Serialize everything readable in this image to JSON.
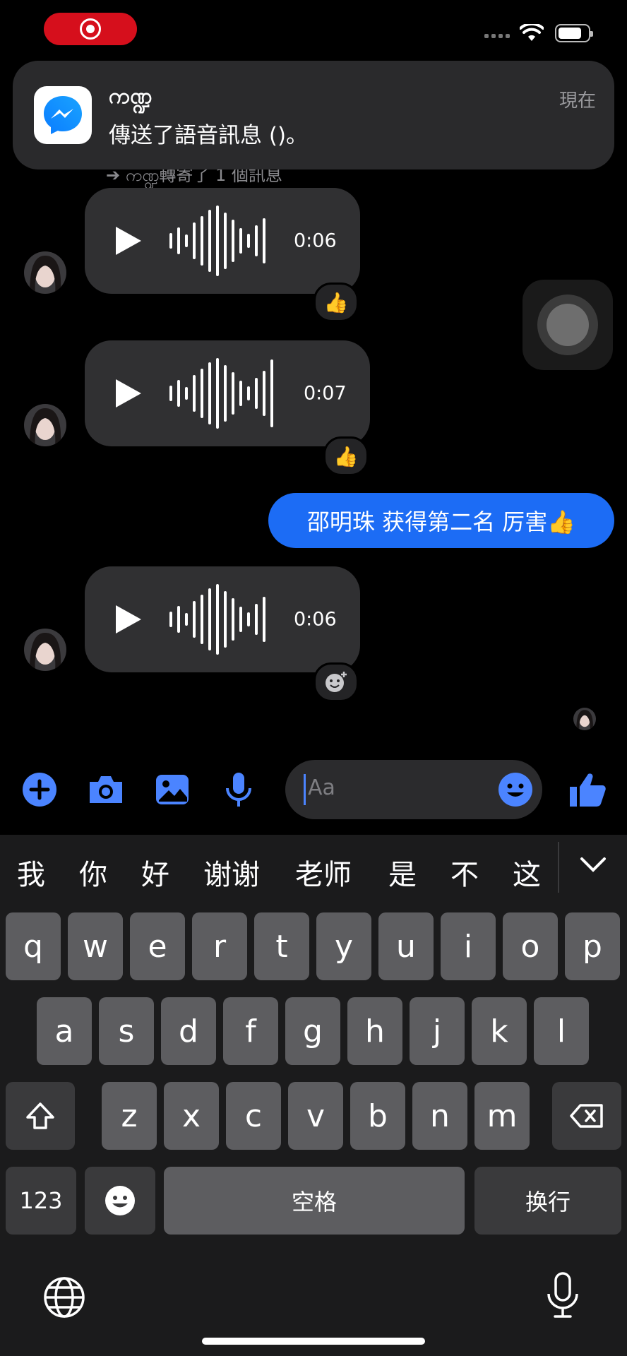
{
  "notification": {
    "title": "ကဏ္ဍ",
    "body": "傳送了語音訊息 ()。",
    "time": "現在",
    "behind_text": "➔ ကဏ္ဍ轉寄了 1 個訊息"
  },
  "messages": [
    {
      "type": "voice",
      "duration": "0:06",
      "reaction": "👍"
    },
    {
      "type": "voice",
      "duration": "0:07",
      "reaction": "👍"
    },
    {
      "type": "outgoing_text",
      "text": "邵明珠 获得第二名 厉害👍"
    },
    {
      "type": "voice",
      "duration": "0:06",
      "reaction": "add-reaction-icon"
    }
  ],
  "composer": {
    "placeholder": "Aa",
    "icons": [
      "plus-icon",
      "camera-icon",
      "image-icon",
      "microphone-icon",
      "emoji-icon",
      "thumbs-up-icon"
    ]
  },
  "keyboard": {
    "candidates": [
      "我",
      "你",
      "好",
      "谢谢",
      "老师",
      "是",
      "不",
      "这"
    ],
    "row1": [
      "q",
      "w",
      "e",
      "r",
      "t",
      "y",
      "u",
      "i",
      "o",
      "p"
    ],
    "row2": [
      "a",
      "s",
      "d",
      "f",
      "g",
      "h",
      "j",
      "k",
      "l"
    ],
    "row3": [
      "z",
      "x",
      "c",
      "v",
      "b",
      "n",
      "m"
    ],
    "numbers_key": "123",
    "space_key": "空格",
    "return_key": "换行"
  },
  "colors": {
    "accent_blue": "#1c6cf5",
    "icon_blue": "#4b84ff",
    "record_red": "#d60f1c",
    "bubble_gray": "#303032"
  }
}
